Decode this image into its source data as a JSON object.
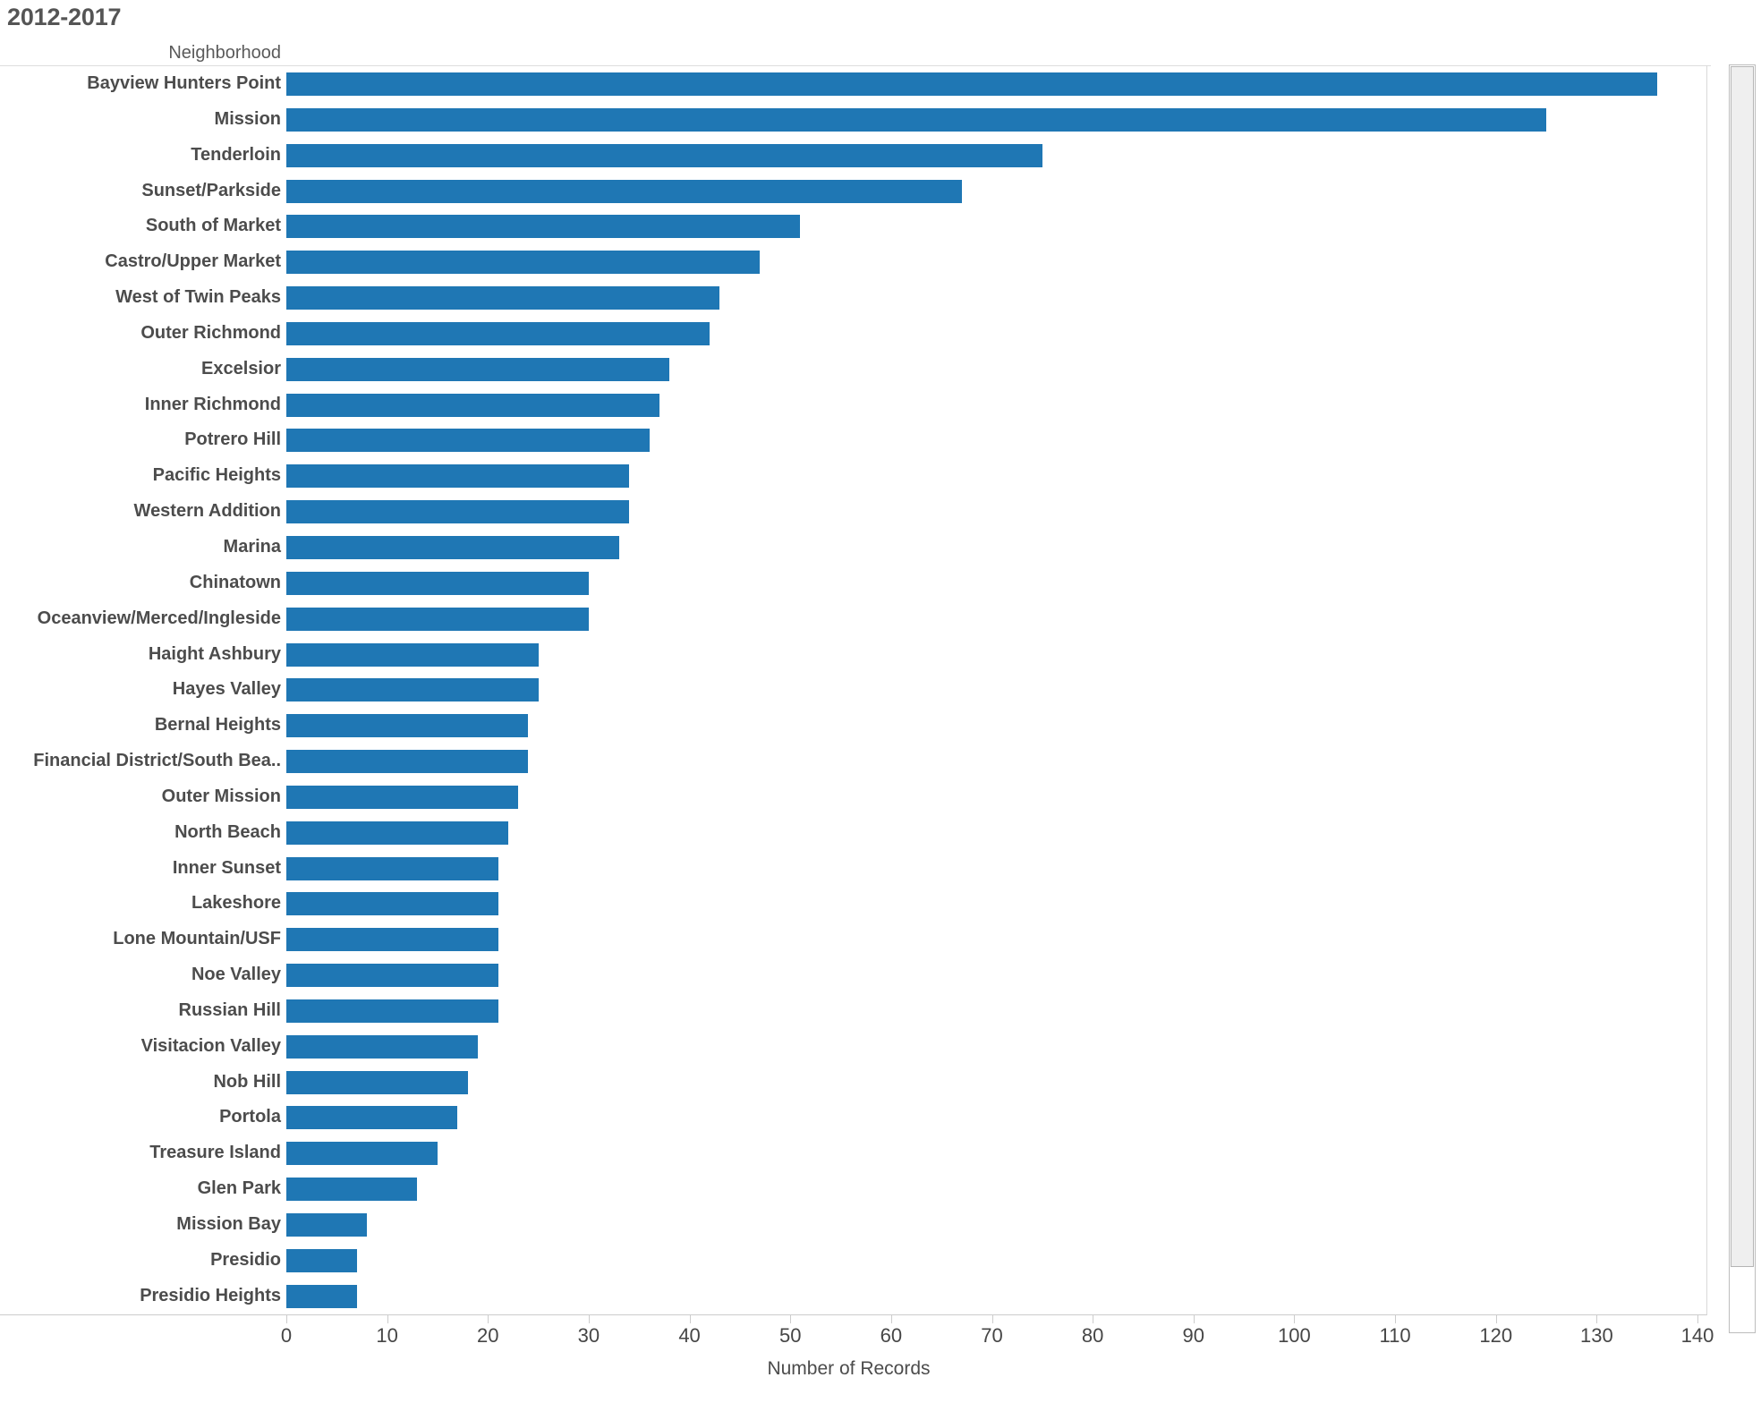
{
  "page_title": "2012-2017",
  "column_header": "Neighborhood",
  "x_axis_title": "Number of Records",
  "colors": {
    "bar": "#1f77b4",
    "label_text": "#4c4c4c",
    "title_text": "#555555"
  },
  "scrollbar": {
    "orientation": "vertical",
    "position": "right"
  },
  "chart_data": {
    "type": "bar",
    "orientation": "horizontal",
    "title": "2012-2017",
    "xlabel": "Number of Records",
    "ylabel": "Neighborhood",
    "xlim": [
      0,
      140
    ],
    "xticks": [
      0,
      10,
      20,
      30,
      40,
      50,
      60,
      70,
      80,
      90,
      100,
      110,
      120,
      130,
      140
    ],
    "grid": false,
    "legend": null,
    "bar_color": "#1f77b4",
    "categories": [
      "Bayview Hunters Point",
      "Mission",
      "Tenderloin",
      "Sunset/Parkside",
      "South of Market",
      "Castro/Upper Market",
      "West of Twin Peaks",
      "Outer Richmond",
      "Excelsior",
      "Inner Richmond",
      "Potrero Hill",
      "Pacific Heights",
      "Western Addition",
      "Marina",
      "Chinatown",
      "Oceanview/Merced/Ingleside",
      "Haight Ashbury",
      "Hayes Valley",
      "Bernal Heights",
      "Financial District/South Bea..",
      "Outer Mission",
      "North Beach",
      "Inner Sunset",
      "Lakeshore",
      "Lone Mountain/USF",
      "Noe Valley",
      "Russian Hill",
      "Visitacion Valley",
      "Nob Hill",
      "Portola",
      "Treasure Island",
      "Glen Park",
      "Mission Bay",
      "Presidio",
      "Presidio Heights"
    ],
    "values": [
      136,
      125,
      75,
      67,
      51,
      47,
      43,
      42,
      38,
      37,
      36,
      34,
      34,
      33,
      30,
      30,
      25,
      25,
      24,
      24,
      23,
      22,
      21,
      21,
      21,
      21,
      21,
      19,
      18,
      17,
      15,
      13,
      8,
      7,
      7
    ]
  }
}
